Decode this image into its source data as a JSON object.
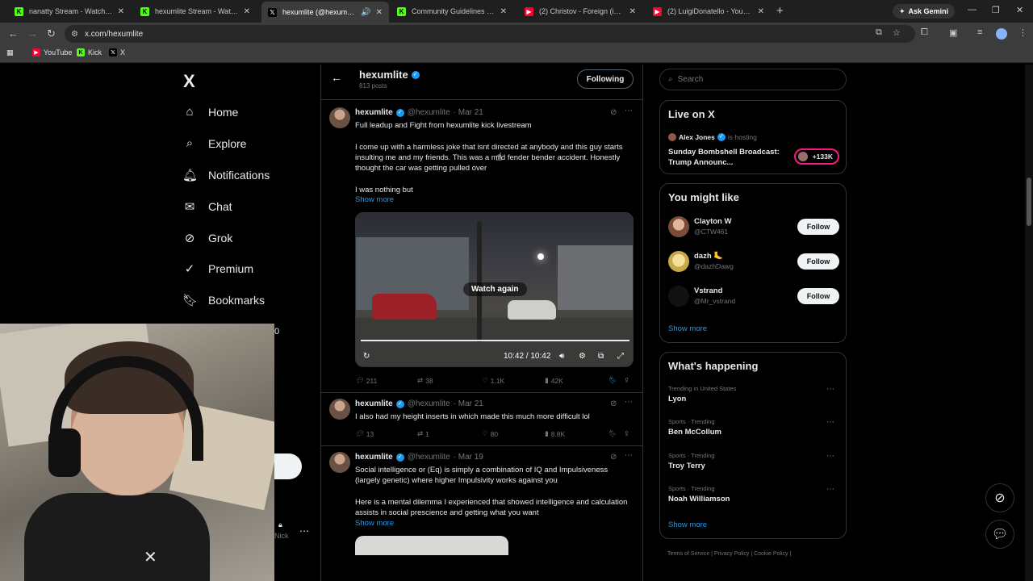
{
  "browser": {
    "tabs": [
      {
        "title": "nanatty Stream - Watch Live on",
        "favicon_color": "#53fc18"
      },
      {
        "title": "hexumlite Stream - Watch Live",
        "favicon_color": "#53fc18"
      },
      {
        "title": "hexumlite (@hexumlite) / X",
        "favicon_color": "#ffffff"
      },
      {
        "title": "Community Guidelines - Kick S",
        "favicon_color": "#53fc18"
      },
      {
        "title": "(2) Christov - Foreign (iamMAN",
        "favicon_color": "#ff0033"
      },
      {
        "title": "(2) LuigiDonatello - YouTube",
        "favicon_color": "#ff0033"
      }
    ],
    "active_tab_index": 2,
    "gemini_label": "Ask Gemini",
    "url": "x.com/hexumlite",
    "bookmarks": [
      {
        "label": "YouTube",
        "favicon_color": "#ff0033"
      },
      {
        "label": "Kick",
        "favicon_color": "#53fc18"
      },
      {
        "label": "X",
        "favicon_color": "#ffffff"
      }
    ]
  },
  "sidebar": {
    "logo": "X",
    "items": [
      {
        "label": "Home",
        "icon": "home-icon"
      },
      {
        "label": "Explore",
        "icon": "search-icon"
      },
      {
        "label": "Notifications",
        "icon": "bell-icon"
      },
      {
        "label": "Chat",
        "icon": "mail-icon"
      },
      {
        "label": "Grok",
        "icon": "grok-icon"
      },
      {
        "label": "Premium",
        "icon": "verified-icon"
      },
      {
        "label": "Bookmarks",
        "icon": "bookmark-icon"
      }
    ],
    "partial_digit": "0",
    "partial_label": "Nick"
  },
  "profile": {
    "name": "hexumlite",
    "posts_count": "813 posts",
    "following_label": "Following"
  },
  "tweets": [
    {
      "name": "hexumlite",
      "handle": "@hexumlite",
      "date": "· Mar 21",
      "title_line": "Full leadup and Fight from hexumlite kick livestream",
      "body": "I come up with a harmless joke that isnt directed at anybody and this guy starts insulting me and my friends. This was a mild fender bender accident. Honestly thought the car was getting pulled over",
      "body2": "I was nothing but",
      "show_more": "Show more",
      "video": {
        "overlay_label": "Watch again",
        "time": "10:42 / 10:42",
        "progress_fraction": 1.0
      },
      "replies": "211",
      "reposts": "38",
      "likes": "1.1K",
      "views": "42K"
    },
    {
      "name": "hexumlite",
      "handle": "@hexumlite",
      "date": "· Mar 21",
      "body": "I also had my height inserts in which made this much more difficult lol",
      "replies": "13",
      "reposts": "1",
      "likes": "80",
      "views": "8.8K"
    },
    {
      "name": "hexumlite",
      "handle": "@hexumlite",
      "date": "· Mar 19",
      "body": "Social intelligence or (Eq) is simply a combination of IQ and Impulsiveness (largely genetic) where higher Impulsivity works against you",
      "body2": "Here is a mental dilemma I experienced that showed intelligence and calculation assists in social prescience and getting what you want",
      "show_more": "Show more"
    }
  ],
  "right": {
    "search_placeholder": "Search",
    "live": {
      "title": "Live on X",
      "host_name": "Alex Jones",
      "host_suffix": "is hosting",
      "broadcast_title": "Sunday Bombshell Broadcast: Trump Announc...",
      "listeners": "+133K",
      "accent": "#f91880"
    },
    "you_might_like": {
      "title": "You might like",
      "users": [
        {
          "name": "Clayton W",
          "handle": "@CTW461",
          "button": "Follow"
        },
        {
          "name": "dazh 🦶",
          "handle": "@dazhDawg",
          "button": "Follow"
        },
        {
          "name": "Vstrand",
          "handle": "@Mr_vstrand",
          "button": "Follow"
        }
      ],
      "show_more": "Show more"
    },
    "whats_happening": {
      "title": "What's happening",
      "trends": [
        {
          "context": "Trending in United States",
          "topic": "Lyon"
        },
        {
          "context": "Sports · Trending",
          "topic": "Ben McCollum"
        },
        {
          "context": "Sports · Trending",
          "topic": "Troy Terry"
        },
        {
          "context": "Sports · Trending",
          "topic": "Noah Williamson"
        }
      ],
      "show_more": "Show more"
    },
    "footer": "Terms of Service  |  Privacy Policy  |  Cookie Policy  |"
  },
  "colors": {
    "accent_blue": "#1d9bf0",
    "background": "#000000",
    "border": "#2f3336",
    "muted_text": "#71767b"
  }
}
